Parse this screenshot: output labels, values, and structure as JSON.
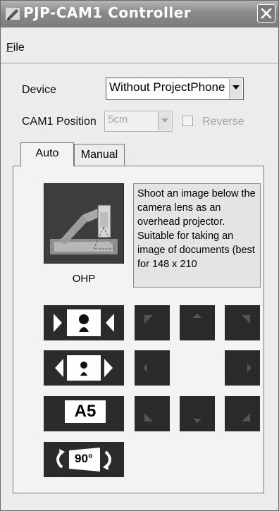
{
  "window": {
    "title": "PJP-CAM1 Controller",
    "title_icon": "pen-app-icon",
    "close_icon": "close-icon"
  },
  "menu": {
    "file_label": "File"
  },
  "device": {
    "label": "Device",
    "value": "Without ProjectPhone"
  },
  "cam1_position": {
    "label": "CAM1 Position",
    "value": "5cm",
    "enabled": false
  },
  "reverse": {
    "label": "Reverse",
    "checked": false,
    "enabled": false
  },
  "tabs": [
    {
      "label": "Auto",
      "active": true
    },
    {
      "label": "Manual",
      "active": false
    }
  ],
  "mode": {
    "name": "OHP",
    "icon": "ohp-camera-icon",
    "description": "Shoot an image below the camera lens as an overhead projector. Suitable for taking an image of documents (best for 148 x 210"
  },
  "controls": {
    "zoom_in_icon": "zoom-in-icon",
    "zoom_out_icon": "zoom-out-icon",
    "paper_size_label": "A5",
    "rotate_label": "90°",
    "rotate_icon": "rotate-icon",
    "directions": [
      "up-left",
      "up",
      "up-right",
      "left",
      "right",
      "down-left",
      "down",
      "down-right"
    ]
  },
  "colors": {
    "titlebar": "#8a8a8a",
    "dark_button": "#2b2b2b",
    "direction_button": "#2a2a2a",
    "disabled_text": "#a5a5a5"
  }
}
